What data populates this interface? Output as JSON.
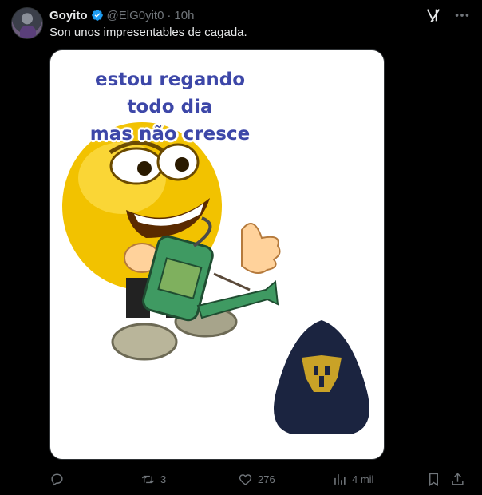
{
  "author": {
    "name": "Goyito",
    "handle": "@ElG0yit0",
    "separator": "·",
    "time": "10h"
  },
  "tweet": {
    "text": "Son unos impresentables de cagada."
  },
  "media": {
    "caption_lines": [
      "estou regando",
      "todo dia",
      "mas não cresce"
    ]
  },
  "actions": {
    "replies": "",
    "retweets": "3",
    "likes": "276",
    "views": "4 mil"
  },
  "colors": {
    "background": "#000000",
    "text": "#e7e9ea",
    "muted": "#71767b",
    "verified": "#1d9bf0",
    "caption": "#3d47a8",
    "badge_navy": "#1b2440",
    "badge_gold": "#c9a227"
  },
  "icons": [
    "verified-badge-icon",
    "grok-icon",
    "more-icon",
    "reply-icon",
    "retweet-icon",
    "like-icon",
    "views-icon",
    "bookmark-icon",
    "share-icon"
  ]
}
